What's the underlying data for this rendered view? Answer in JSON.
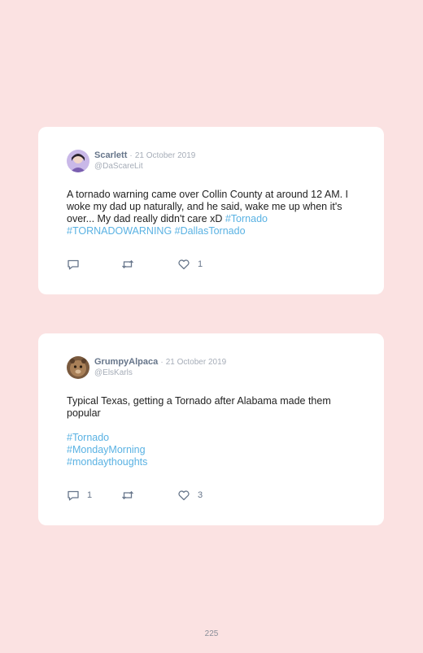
{
  "page": {
    "number": "225",
    "background": "#fbe2e2"
  },
  "colors": {
    "hashtag": "#5ab2e3",
    "name": "#66758a",
    "meta": "#a6adb8",
    "text": "#222222"
  },
  "tweets": [
    {
      "author": "Scarlett",
      "separator": "·",
      "date": "21 October 2019",
      "handle": "@DaScareLit",
      "avatar": "avatar-purple-icon",
      "text_plain": "A tornado warning came over Collin County at around 12 AM. I woke my dad up naturally, and he said, wake me up when it's over... My dad really didn't care xD",
      "hashtags": [
        "#Tornado",
        "#TORNADOWARNING",
        "#DallasTornado"
      ],
      "reply_count": "",
      "retweet_count": "",
      "like_count": "1"
    },
    {
      "author": "GrumpyAlpaca",
      "separator": "·",
      "date": "21 October 2019",
      "handle": "@ElsKarls",
      "avatar": "avatar-alpaca-icon",
      "text_plain": "Typical Texas, getting a Tornado after Alabama made them popular",
      "hashtags": [
        "#Tornado",
        "#MondayMorning",
        "#mondaythoughts"
      ],
      "reply_count": "1",
      "retweet_count": "",
      "like_count": "3"
    }
  ]
}
